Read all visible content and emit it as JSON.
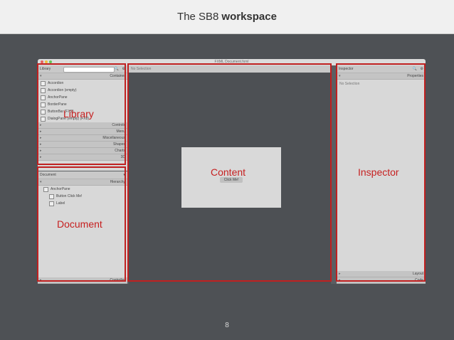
{
  "slide": {
    "title_prefix": "The SB8",
    "title_bold": "workspace",
    "page_number": "8"
  },
  "window": {
    "title": "FXML Document.fxml"
  },
  "library": {
    "header": "Library",
    "container_section": "Container",
    "items": [
      "Accordion",
      "Accordion (empty)",
      "AnchorPane",
      "BorderPane",
      "ButtonBar (FXS)",
      "DialogPane (empty) (FX8)"
    ],
    "sections": [
      "Controls",
      "Menu",
      "Miscellaneous",
      "Shapes",
      "Charts",
      "3D"
    ],
    "overlay_label": "Library"
  },
  "document": {
    "header": "Document",
    "hierarchy_section": "Hierarchy",
    "tree": [
      {
        "label": "AnchorPane"
      },
      {
        "label": "Button  Click Me!"
      },
      {
        "label": "Label"
      }
    ],
    "controller_section": "Controller",
    "overlay_label": "Document"
  },
  "content": {
    "top_bar": "No Selection",
    "button_label": "Click Me!",
    "overlay_label": "Content"
  },
  "inspector": {
    "header": "Inspector",
    "properties_section": "Properties",
    "empty_text": "No Selection",
    "layout_section": "Layout",
    "code_section": "Code",
    "overlay_label": "Inspector"
  },
  "colors": {
    "highlight": "#c02020",
    "background": "#4e5155"
  }
}
